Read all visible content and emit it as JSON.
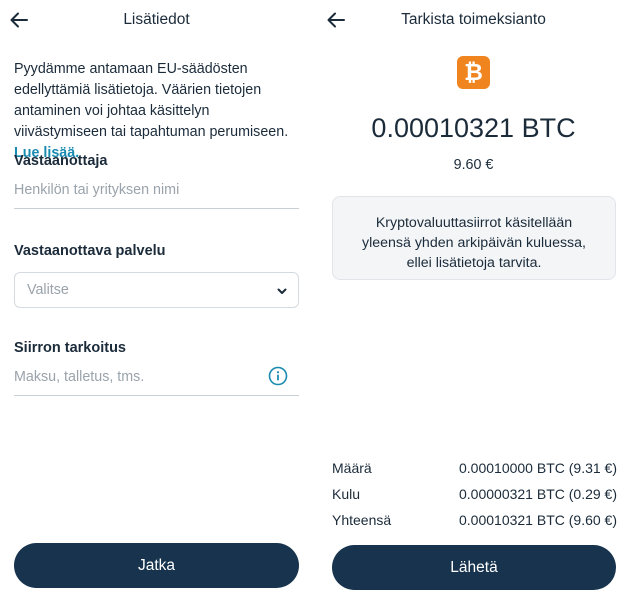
{
  "left": {
    "title": "Lisätiedot",
    "intro_text": "Pyydämme antamaan EU-säädösten edellyttämiä lisätietoja. Väärien tietojen antaminen voi johtaa käsittelyn viivästymiseen tai tapahtuman perumiseen.",
    "intro_link": "Lue lisää.",
    "recipient_label": "Vastaanottaja",
    "recipient_placeholder": "Henkilön tai yrityksen nimi",
    "service_label": "Vastaanottava palvelu",
    "service_value": "Valitse",
    "purpose_label": "Siirron tarkoitus",
    "purpose_placeholder": "Maksu, talletus, tms.",
    "continue_label": "Jatka"
  },
  "right": {
    "title": "Tarkista toimeksianto",
    "coin_glyph": "₿",
    "crypto_amount": "0.00010321 BTC",
    "fiat_amount": "9.60 €",
    "notice": "Kryptovaluuttasiirrot käsitellään yleensä yhden arkipäivän kuluessa, ellei lisätietoja tarvita.",
    "summary": [
      {
        "label": "Määrä",
        "value": "0.00010000 BTC (9.31 €)"
      },
      {
        "label": "Kulu",
        "value": "0.00000321 BTC (0.29 €)"
      },
      {
        "label": "Yhteensä",
        "value": "0.00010321 BTC (9.60 €)"
      }
    ],
    "send_label": "Lähetä"
  },
  "colors": {
    "primary_button": "#17334d",
    "link": "#1a8bb0",
    "bitcoin": "#f0851f",
    "text": "#1b2b3a"
  },
  "icons": [
    "back-arrow-icon",
    "chevron-down-icon",
    "info-icon",
    "bitcoin-icon"
  ]
}
